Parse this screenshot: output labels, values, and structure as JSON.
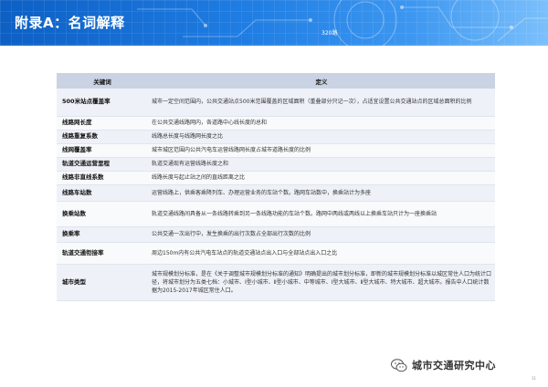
{
  "header": {
    "title": "附录A：名词解释",
    "tag": "320路"
  },
  "table": {
    "col_term": "关键词",
    "col_def": "定义",
    "rows": [
      {
        "term": "500米站点覆盖率",
        "def": "城市一定空间范围内，公共交通站点500米范围覆盖的区域面积（重叠部分只记一次），占适宜设置公共交通站点的区域总面积的比例"
      },
      {
        "term": "线路网长度",
        "def": "在公共交通线路网内，各道路中心线长度的总和"
      },
      {
        "term": "线路重复系数",
        "def": "线路总长度与线路网长度之比"
      },
      {
        "term": "线网覆盖率",
        "def": "城市城区范围内公共汽电车运营线路网长度占城市道路长度的比例"
      },
      {
        "term": "轨道交通运营里程",
        "def": "轨道交通现有运营线路长度之和"
      },
      {
        "term": "线路非直线系数",
        "def": "线路长度与起止站之间的直线距离之比"
      },
      {
        "term": "线路车站数",
        "def": "运营线路上，供乘客乘降列车、办理运营业务的车站个数。路网车站数中，换乘站计为多座"
      },
      {
        "term": "换乘站数",
        "def": "轨道交通线路间具备从一条线路转乘到另一条线路功能的车站个数。路网中两线或两线以上换乘车站只计为一座换乘站"
      },
      {
        "term": "换乘率",
        "def": "公共交通一次出行中，发生换乘的出行次数占全部出行次数的比例"
      },
      {
        "term": "轨道交通衔接率",
        "def": "周边150m内有公共汽电车站点的轨道交通站点出入口与全部站点出入口之比"
      },
      {
        "term": "城市类型",
        "def": "城市规模划分标准，是在《关于调整城市规模划分标准的通知》明确提出的城市划分标准，即新的城市规模划分标准以城区常住人口为统计口径，将城市划分为五类七档：小城市、Ⅰ型小城市、Ⅱ型小城市、中等城市、Ⅰ型大城市、Ⅱ型大城市、特大城市、超大城市。报告中人口统计数据为2015-2017年城区常住人口。"
      }
    ]
  },
  "footer": {
    "brand": "城市交通研究中心",
    "page": "31"
  },
  "colors": {
    "banner": "#1f7de3",
    "header_row": "#c9d3e4",
    "row_odd": "#eef2f8",
    "row_even": "#f8fafc"
  }
}
